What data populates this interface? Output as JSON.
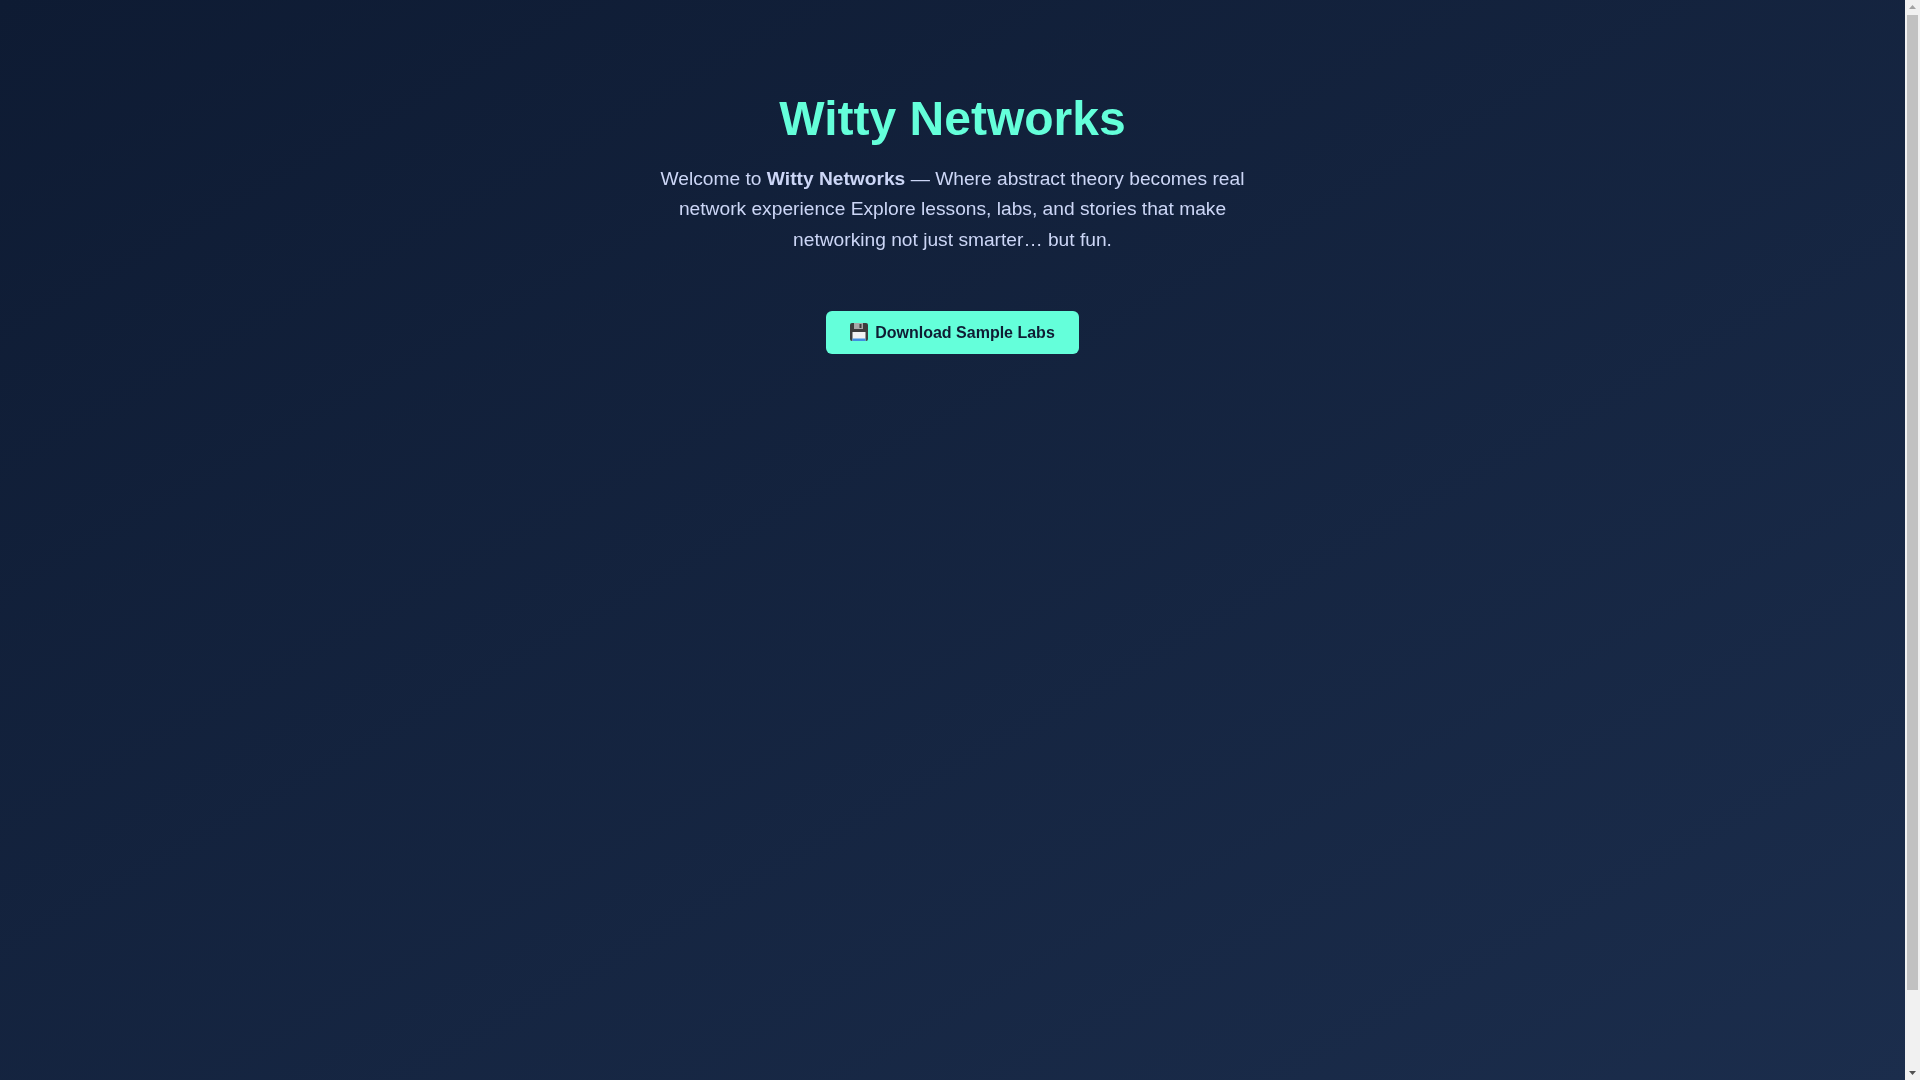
{
  "title": "Witty Networks",
  "intro": "Welcome to **Witty Networks** — Where abstract theory becomes real network experience Explore lessons, labs, and stories that make networking not just smarter… but fun.",
  "download_button": {
    "label": "Download Sample Labs"
  }
}
